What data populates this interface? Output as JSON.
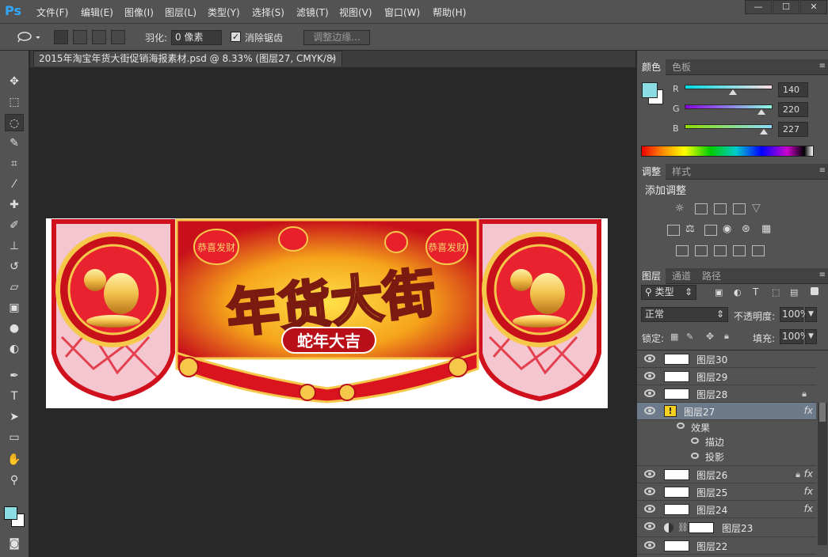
{
  "app": {
    "logo": "Ps"
  },
  "menu": [
    "文件(F)",
    "编辑(E)",
    "图像(I)",
    "图层(L)",
    "类型(Y)",
    "选择(S)",
    "滤镜(T)",
    "视图(V)",
    "窗口(W)",
    "帮助(H)"
  ],
  "window_controls": {
    "minimize": "—",
    "maximize": "☐",
    "close": "✕"
  },
  "options": {
    "feather_label": "羽化:",
    "feather_value": "0 像素",
    "antialias_label": "消除锯齿",
    "refine_edge_label": "调整边缘..."
  },
  "document": {
    "tab_title": "2015年淘宝年货大街促销海报素材.psd @ 8.33% (图层27, CMYK/8)",
    "tab_close": "×"
  },
  "artwork": {
    "title": "年货大街",
    "subtitle": "蛇年大吉",
    "lantern_text": "恭喜发财"
  },
  "color_panel": {
    "tabs": [
      "颜色",
      "色板"
    ],
    "labels": {
      "r": "R",
      "g": "G",
      "b": "B"
    },
    "values": {
      "r": "140",
      "g": "220",
      "b": "227"
    },
    "fg_color": "#8cdce3"
  },
  "adjust_panel": {
    "tabs": [
      "调整",
      "样式"
    ],
    "heading": "添加调整"
  },
  "layers_panel": {
    "tabs": [
      "图层",
      "通道",
      "路径"
    ],
    "filter_label": "类型",
    "blend_mode": "正常",
    "opacity_label": "不透明度:",
    "opacity_value": "100%",
    "lock_label": "锁定:",
    "fill_label": "填充:",
    "fill_value": "100%",
    "effects_label": "效果",
    "effect_stroke": "描边",
    "effect_shadow": "投影",
    "layers": [
      {
        "name": "图层30"
      },
      {
        "name": "图层29"
      },
      {
        "name": "图层28"
      },
      {
        "name": "图层27"
      },
      {
        "name": "图层26"
      },
      {
        "name": "图层25"
      },
      {
        "name": "图层24"
      },
      {
        "name": "图层23"
      },
      {
        "name": "图层22"
      }
    ],
    "fx": "fx"
  }
}
